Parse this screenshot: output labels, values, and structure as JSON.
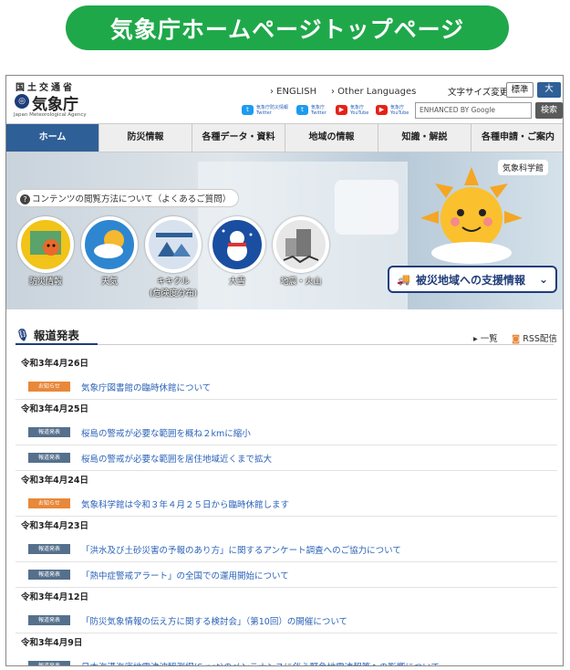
{
  "banner": {
    "title": "気象庁ホームページトップページ"
  },
  "header": {
    "org_top": "国土交通省",
    "logo_name": "気象庁",
    "logo_en": "Japan Meteorological Agency",
    "lang_english": "› ENGLISH",
    "lang_other": "› Other Languages",
    "font_size_label": "文字サイズ変更",
    "font_std": "標準",
    "font_large": "大",
    "social": [
      {
        "icon": "twitter-icon",
        "label": "気象庁防災情報 Twitter"
      },
      {
        "icon": "twitter-icon",
        "label": "気象庁 Twitter"
      },
      {
        "icon": "youtube-icon",
        "label": "気象庁 YouTube"
      },
      {
        "icon": "youtube-icon",
        "label": "気象庁 YouTube"
      }
    ],
    "search_placeholder": "ENHANCED BY Google",
    "search_button": "検索"
  },
  "nav": [
    "ホーム",
    "防災情報",
    "各種データ・資料",
    "地域の情報",
    "知識・解説",
    "各種申請・ご案内"
  ],
  "hero": {
    "faq": "コンテンツの閲覧方法について（よくあるご質問）",
    "kishokan": "気象科学館",
    "circles": [
      {
        "label": "防災情報",
        "color": "#f2c318",
        "icon": "map-icon"
      },
      {
        "label": "天気",
        "color": "#2e86d0",
        "icon": "weather-icon"
      },
      {
        "label": "キキクル\n(危険度分布)",
        "color": "#d8e2ee",
        "icon": "kikikuru-icon"
      },
      {
        "label": "大雪",
        "color": "#1a4ea0",
        "icon": "snow-icon"
      },
      {
        "label": "地震・火山",
        "color": "#e7e7e7",
        "icon": "earthquake-icon"
      }
    ],
    "support": "被災地域への支援情報"
  },
  "press": {
    "heading": "報道発表",
    "list_link": "一覧",
    "rss_link": "RSS配信",
    "groups": [
      {
        "date": "令和3年4月26日",
        "items": [
          {
            "badge": "お知らせ",
            "type": "orange",
            "text": "気象庁図書館の臨時休館について"
          }
        ]
      },
      {
        "date": "令和3年4月25日",
        "items": [
          {
            "badge": "報道発表",
            "type": "blue",
            "text": "桜島の警戒が必要な範囲を概ね２kmに縮小"
          },
          {
            "badge": "報道発表",
            "type": "blue",
            "text": "桜島の警戒が必要な範囲を居住地域近くまで拡大"
          }
        ]
      },
      {
        "date": "令和3年4月24日",
        "items": [
          {
            "badge": "お知らせ",
            "type": "orange",
            "text": "気象科学館は令和３年４月２５日から臨時休館します"
          }
        ]
      },
      {
        "date": "令和3年4月23日",
        "items": [
          {
            "badge": "報道発表",
            "type": "blue",
            "text": "「洪水及び土砂災害の予報のあり方」に関するアンケート調査へのご協力について"
          },
          {
            "badge": "報道発表",
            "type": "blue",
            "text": "「熱中症警戒アラート」の全国での運用開始について"
          }
        ]
      },
      {
        "date": "令和3年4月12日",
        "items": [
          {
            "badge": "報道発表",
            "type": "blue",
            "text": "「防災気象情報の伝え方に関する検討会」（第10回）の開催について"
          }
        ]
      },
      {
        "date": "令和3年4月9日",
        "items": [
          {
            "badge": "報道発表",
            "type": "blue",
            "text": "日本海溝海底地震津波観測網(S-net)のメンテナンスに伴う緊急地震速報等への影響について"
          }
        ]
      }
    ]
  }
}
